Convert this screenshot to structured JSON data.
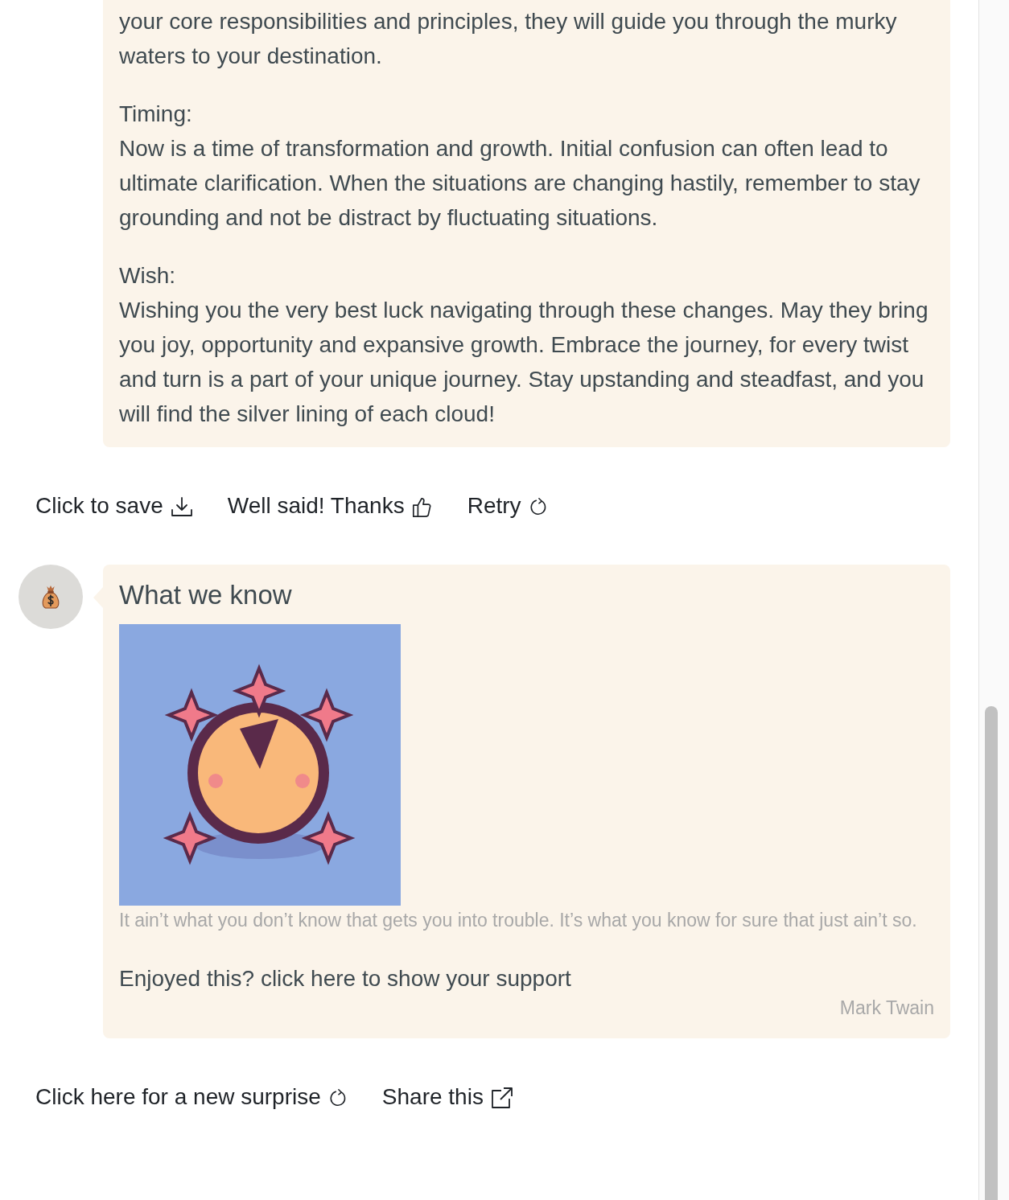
{
  "reading": {
    "paragraphs": [
      {
        "text": "your core responsibilities and principles, they will guide you through the murky waters to your destination."
      },
      {
        "heading": "Timing:",
        "text": "Now is a time of transformation and growth. Initial confusion can often lead to ultimate clarification. When the situations are changing hastily, remember to stay grounding and not be distract by fluctuating situations."
      },
      {
        "heading": "Wish:",
        "text": "Wishing you the very best luck navigating through these changes. May they bring you joy, opportunity and expansive growth. Embrace the journey, for every twist and turn is a part of your unique journey. Stay upstanding and steadfast, and you will find the silver lining of each cloud!"
      }
    ]
  },
  "reading_actions": [
    {
      "label": "Click to save",
      "kind": "save"
    },
    {
      "label": "Well said! Thanks",
      "kind": "thanks"
    },
    {
      "label": "Retry",
      "kind": "retry"
    }
  ],
  "quote_card": {
    "title": "What we know",
    "quote": "It ain’t what you don’t know that gets you into trouble. It’s what you know for sure that just ain’t so.",
    "support_link": "Enjoyed this? click here to show your support",
    "author": "Mark Twain"
  },
  "quote_actions": [
    {
      "label": "Click here for a new surprise",
      "kind": "retry"
    },
    {
      "label": "Share this",
      "kind": "share"
    }
  ]
}
